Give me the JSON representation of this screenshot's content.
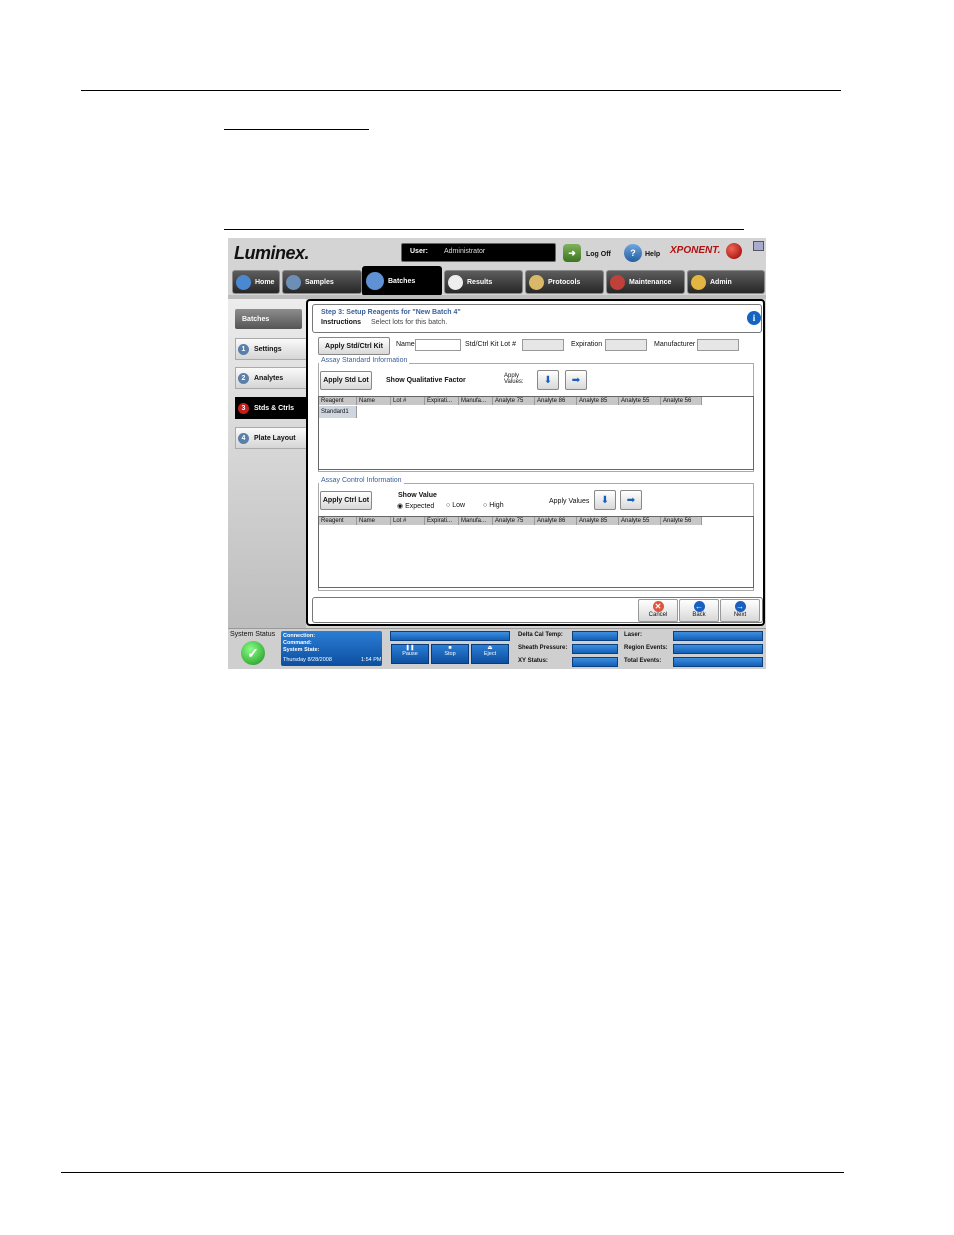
{
  "app": {
    "logo": "Luminex.",
    "user_label": "User:",
    "user_value": "Administrator",
    "logoff": "Log Off",
    "help": "Help",
    "brand": "XPONENT."
  },
  "nav": [
    "Home",
    "Samples",
    "Batches",
    "Results",
    "Protocols",
    "Maintenance",
    "Admin"
  ],
  "sidebar": {
    "title": "Batches",
    "steps": [
      {
        "n": "1",
        "label": "Settings"
      },
      {
        "n": "2",
        "label": "Analytes"
      },
      {
        "n": "3",
        "label": "Stds & Ctrls"
      },
      {
        "n": "4",
        "label": "Plate Layout"
      }
    ]
  },
  "header": {
    "title": "Step 3: Setup Reagents for \"New Batch 4\"",
    "instructions_label": "Instructions",
    "instructions_text": "Select lots for this batch."
  },
  "kit": {
    "apply_button": "Apply Std/Ctrl Kit",
    "name_label": "Name",
    "lot_label": "Std/Ctrl Kit Lot #",
    "expiration_label": "Expiration",
    "manufacturer_label": "Manufacturer"
  },
  "std": {
    "group_title": "Assay Standard Information",
    "apply_button": "Apply Std Lot",
    "qual_label": "Show Qualitative Factor",
    "apply_values": "Apply Values:",
    "columns": [
      "Reagent",
      "Name",
      "Lot #",
      "Expirati...",
      "Manufa...",
      "Analyte 75",
      "Analyte 86",
      "Analyte 85",
      "Analyte 55",
      "Analyte 56"
    ],
    "rows": [
      "Standard1"
    ]
  },
  "ctrl": {
    "group_title": "Assay Control Information",
    "apply_button": "Apply Ctrl Lot",
    "show_value": "Show Value",
    "options": [
      "Expected",
      "Low",
      "High"
    ],
    "apply_values": "Apply Values",
    "columns": [
      "Reagent",
      "Name",
      "Lot #",
      "Expirati...",
      "Manufa...",
      "Analyte 75",
      "Analyte 86",
      "Analyte 85",
      "Analyte 55",
      "Analyte 56"
    ]
  },
  "footer": {
    "cancel": "Cancel",
    "back": "Back",
    "next": "Next"
  },
  "status": {
    "system_status": "System Status",
    "connection": "Connection:",
    "command": "Command:",
    "system_state": "System State:",
    "date": "Thursday 8/28/2008",
    "time": "1:54 PM",
    "pause": "Pause",
    "stop": "Stop",
    "eject": "Eject",
    "delta_cal": "Delta Cal Temp:",
    "sheath": "Sheath Pressure:",
    "xy": "XY Status:",
    "laser": "Laser:",
    "region": "Region Events:",
    "total": "Total Events:"
  }
}
